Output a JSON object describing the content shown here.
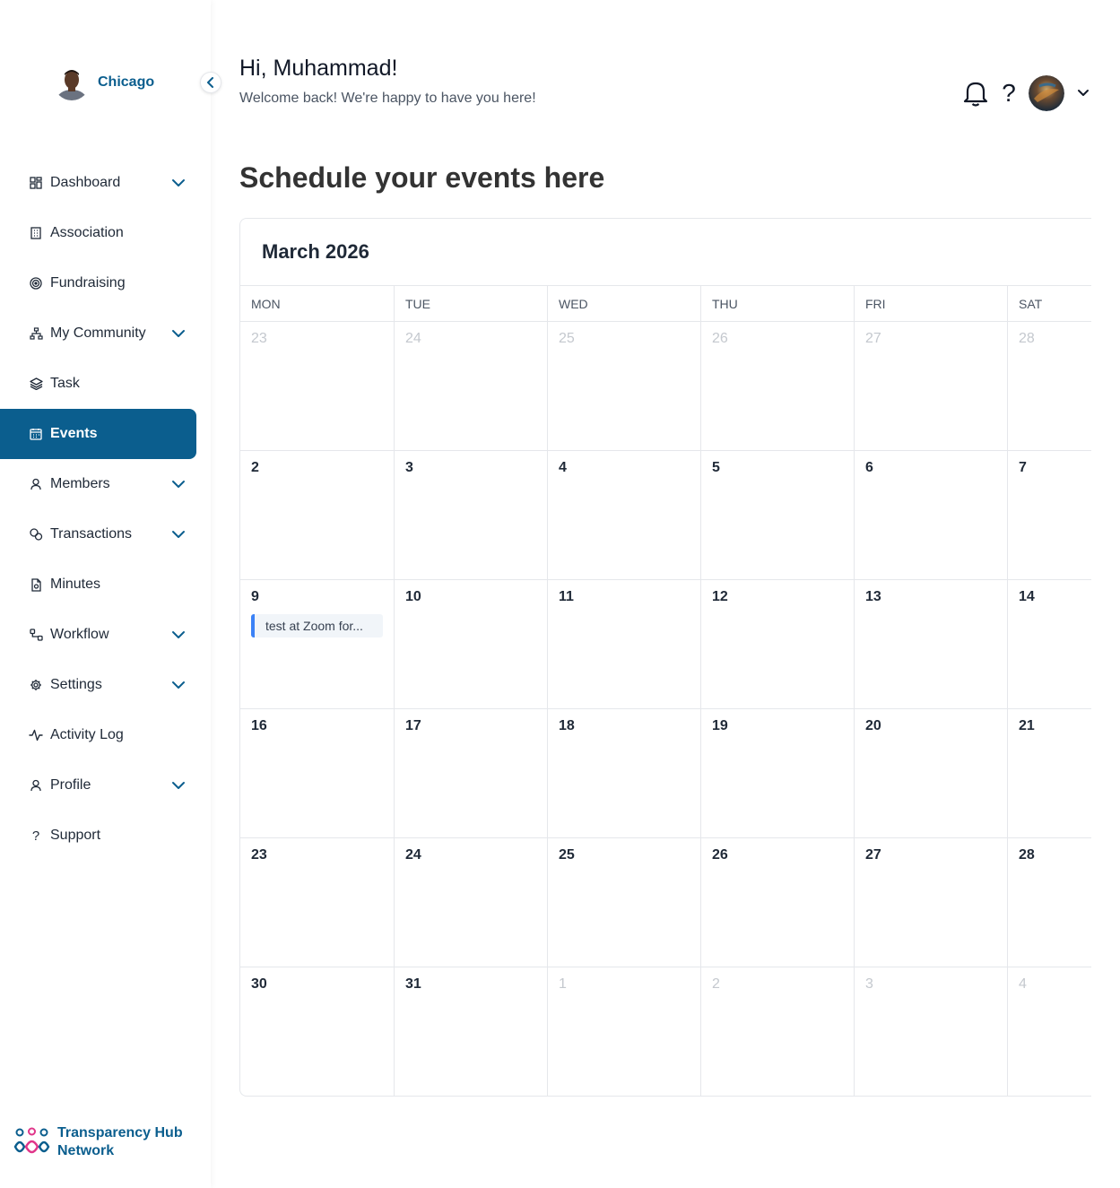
{
  "sidebar": {
    "org_name": "Chicago",
    "items": [
      {
        "label": "Dashboard",
        "icon": "dashboard-icon",
        "has_submenu": true
      },
      {
        "label": "Association",
        "icon": "building-icon",
        "has_submenu": false
      },
      {
        "label": "Fundraising",
        "icon": "target-icon",
        "has_submenu": false
      },
      {
        "label": "My Community",
        "icon": "network-icon",
        "has_submenu": true
      },
      {
        "label": "Task",
        "icon": "layers-icon",
        "has_submenu": false
      },
      {
        "label": "Events",
        "icon": "calendar-icon",
        "has_submenu": false,
        "active": true
      },
      {
        "label": "Members",
        "icon": "user-icon",
        "has_submenu": true
      },
      {
        "label": "Transactions",
        "icon": "coins-icon",
        "has_submenu": true
      },
      {
        "label": "Minutes",
        "icon": "document-icon",
        "has_submenu": false
      },
      {
        "label": "Workflow",
        "icon": "workflow-icon",
        "has_submenu": true
      },
      {
        "label": "Settings",
        "icon": "gear-icon",
        "has_submenu": true
      },
      {
        "label": "Activity Log",
        "icon": "activity-icon",
        "has_submenu": false
      },
      {
        "label": "Profile",
        "icon": "user-icon",
        "has_submenu": true
      },
      {
        "label": "Support",
        "icon": "question-icon",
        "has_submenu": false
      }
    ],
    "brand_line1": "Transparency Hub",
    "brand_line2": "Network"
  },
  "header": {
    "greeting": "Hi, Muhammad!",
    "welcome": "Welcome back! We're happy to have you here!",
    "help_label": "?"
  },
  "page_title": "Schedule your events here",
  "calendar": {
    "month_label": "March 2026",
    "weekdays": [
      "MON",
      "TUE",
      "WED",
      "THU",
      "FRI",
      "SAT"
    ],
    "weeks": [
      [
        {
          "day": "23",
          "muted": true
        },
        {
          "day": "24",
          "muted": true
        },
        {
          "day": "25",
          "muted": true
        },
        {
          "day": "26",
          "muted": true
        },
        {
          "day": "27",
          "muted": true
        },
        {
          "day": "28",
          "muted": true
        }
      ],
      [
        {
          "day": "2"
        },
        {
          "day": "3"
        },
        {
          "day": "4"
        },
        {
          "day": "5"
        },
        {
          "day": "6"
        },
        {
          "day": "7"
        }
      ],
      [
        {
          "day": "9",
          "events": [
            "test at Zoom for..."
          ]
        },
        {
          "day": "10"
        },
        {
          "day": "11"
        },
        {
          "day": "12"
        },
        {
          "day": "13"
        },
        {
          "day": "14"
        }
      ],
      [
        {
          "day": "16"
        },
        {
          "day": "17"
        },
        {
          "day": "18"
        },
        {
          "day": "19"
        },
        {
          "day": "20"
        },
        {
          "day": "21"
        }
      ],
      [
        {
          "day": "23"
        },
        {
          "day": "24"
        },
        {
          "day": "25"
        },
        {
          "day": "26"
        },
        {
          "day": "27"
        },
        {
          "day": "28"
        }
      ],
      [
        {
          "day": "30"
        },
        {
          "day": "31"
        },
        {
          "day": "1",
          "muted": true
        },
        {
          "day": "2",
          "muted": true
        },
        {
          "day": "3",
          "muted": true
        },
        {
          "day": "4",
          "muted": true
        }
      ]
    ]
  },
  "colors": {
    "primary": "#0b5e8e",
    "event_accent": "#3b82f6",
    "brand_pink": "#e0368a"
  }
}
